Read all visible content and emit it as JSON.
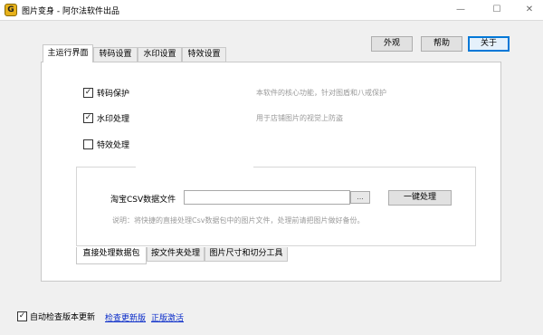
{
  "window": {
    "icon_glyph": "G",
    "title": "图片变身 - 阿尔法软件出品",
    "minimize_glyph": "—",
    "maximize_glyph": "☐",
    "close_glyph": "✕"
  },
  "top_buttons": {
    "about_appearance": "外观",
    "help": "帮助",
    "about": "关于"
  },
  "tabs": [
    {
      "label": "主运行界面"
    },
    {
      "label": "转码设置"
    },
    {
      "label": "水印设置"
    },
    {
      "label": "特效设置"
    }
  ],
  "options": [
    {
      "label": "转码保护",
      "checked": true,
      "desc": "本软件的核心功能，针对图盾和八戒保护"
    },
    {
      "label": "水印处理",
      "checked": true,
      "desc": "用于店铺图片的视觉上防盗"
    },
    {
      "label": "特效处理",
      "checked": false,
      "desc": ""
    }
  ],
  "csv": {
    "label": "淘宝CSV数据文件",
    "value": "",
    "browse": "...",
    "process": "一键处理",
    "note": "说明：将快捷的直接处理Csv数据包中的图片文件，处理前请把图片做好备份。"
  },
  "bottom_tabs": [
    {
      "label": "直接处理数据包"
    },
    {
      "label": "按文件夹处理"
    },
    {
      "label": "图片尺寸和切分工具"
    }
  ],
  "footer": {
    "auto_check_label": "自动检查版本更新",
    "auto_check_checked": true,
    "check_update": "检查更新版",
    "activate": "正版激活"
  }
}
